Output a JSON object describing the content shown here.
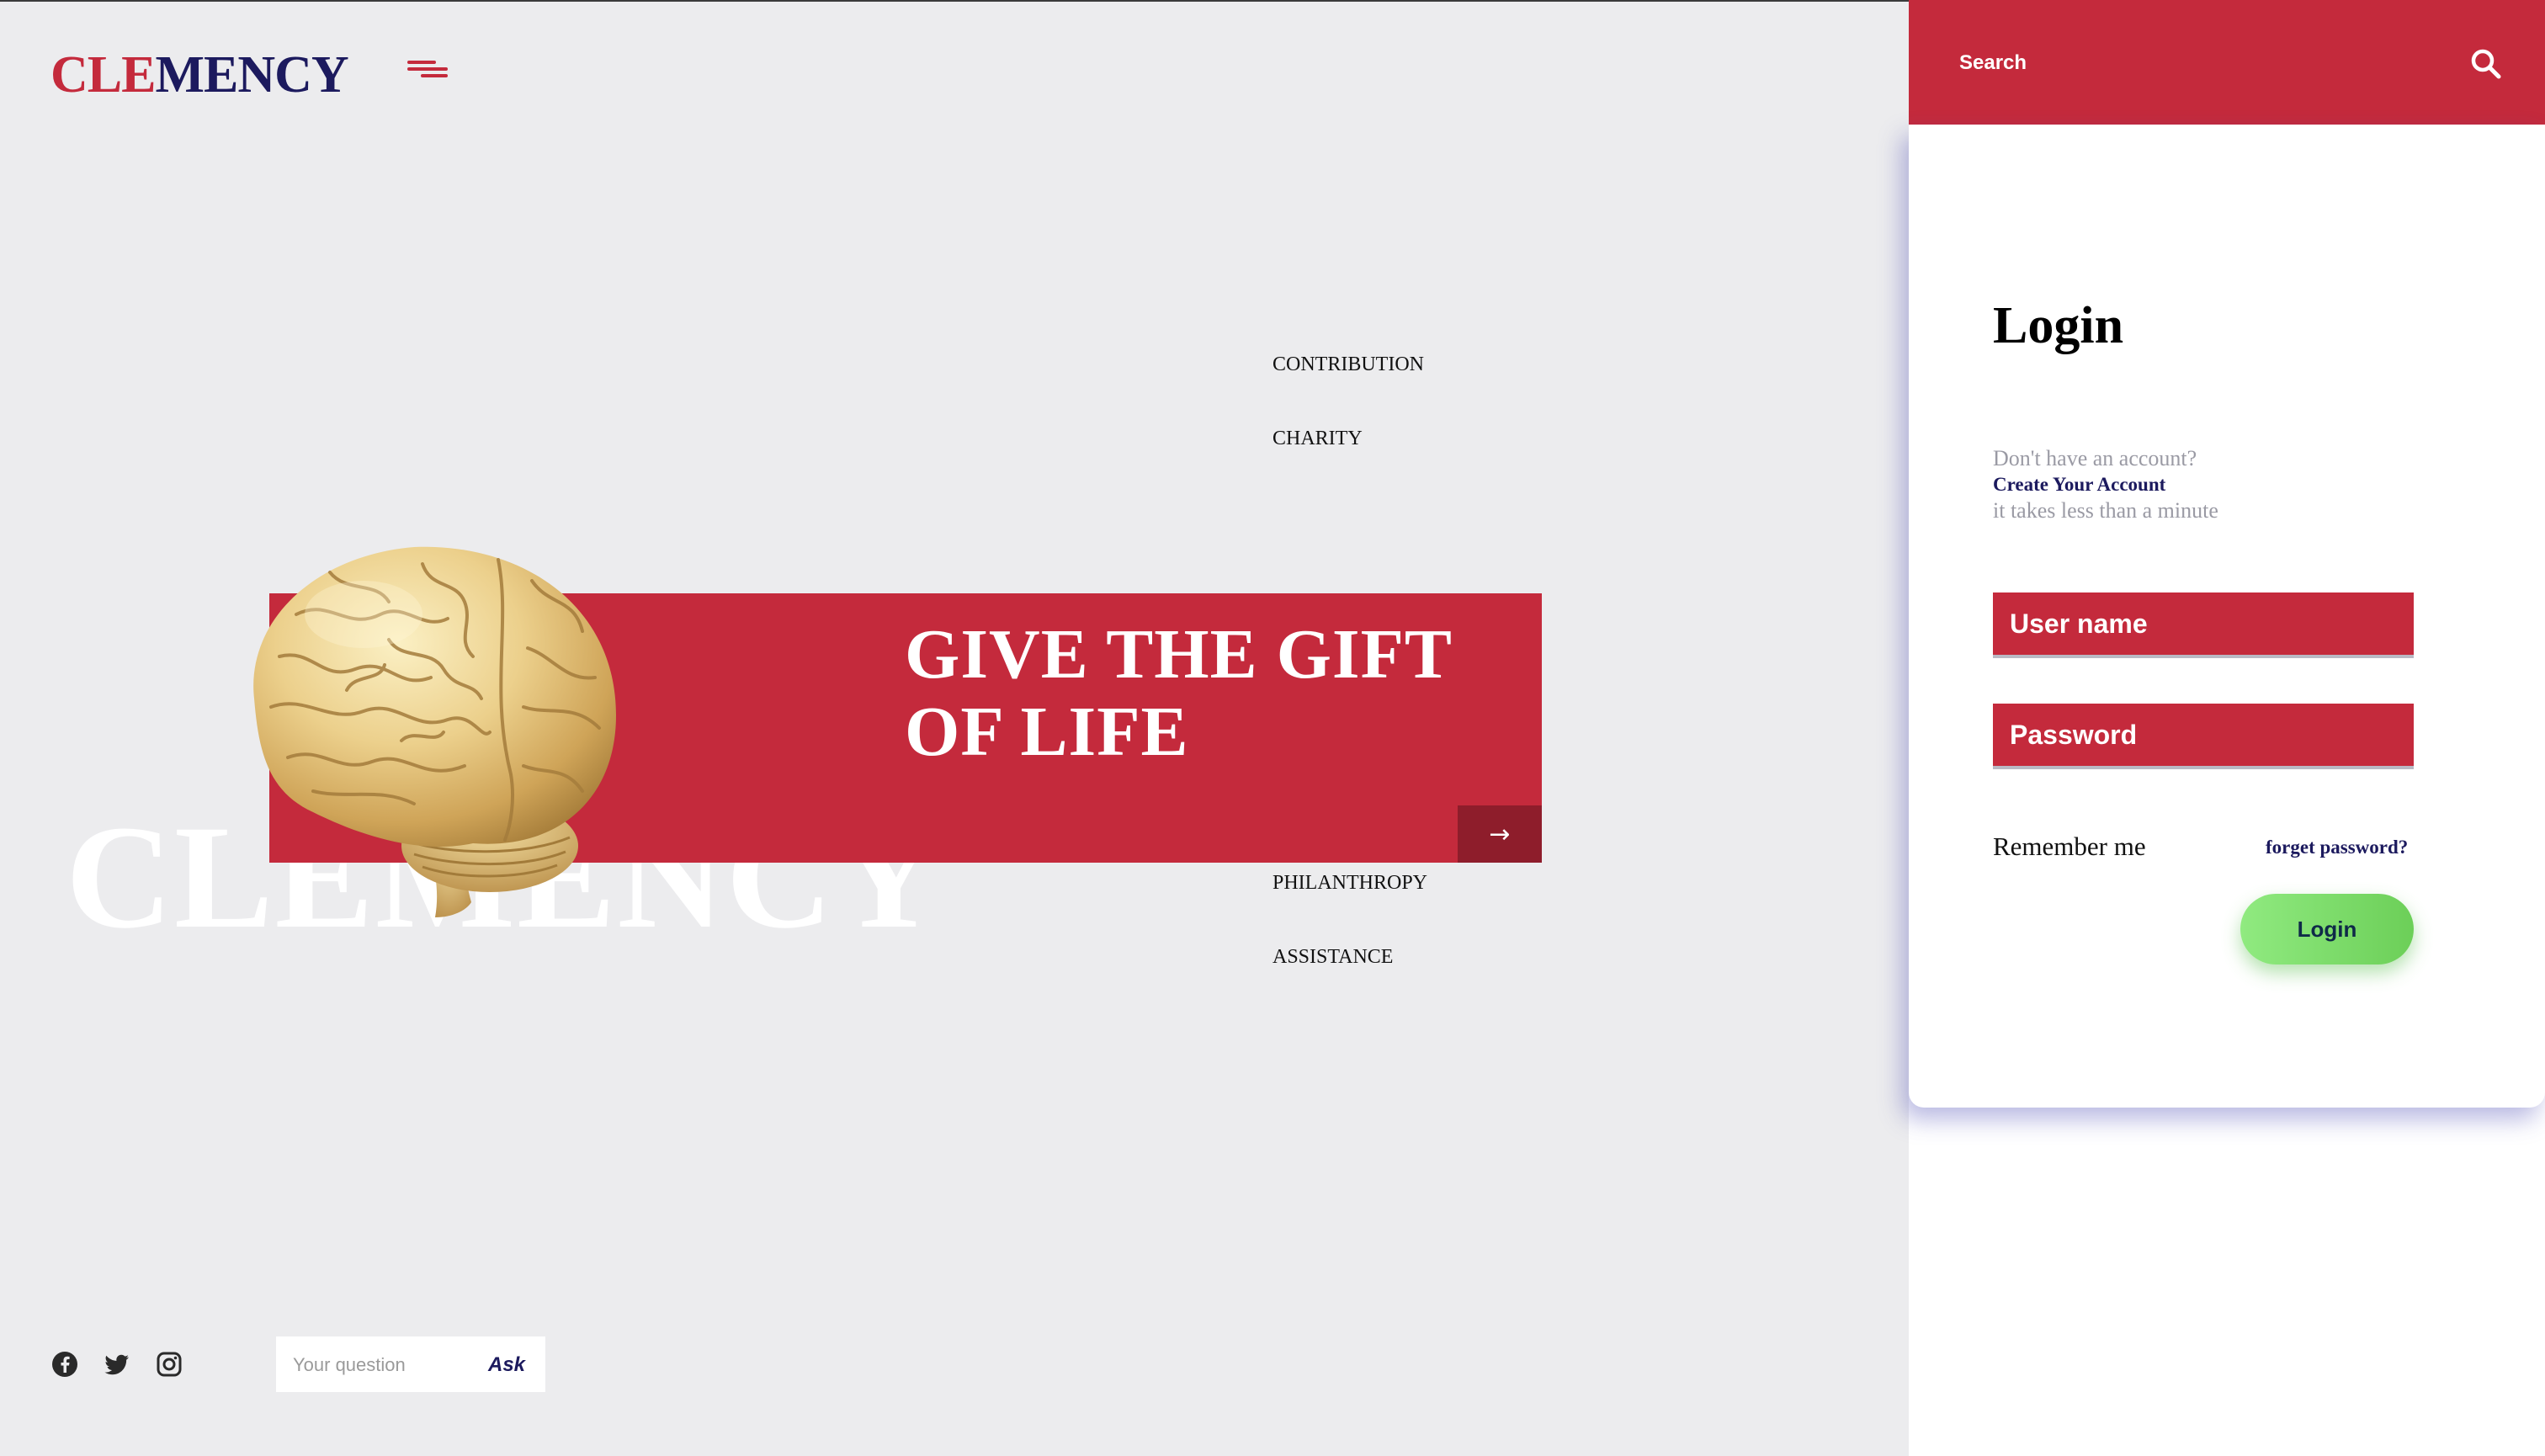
{
  "header": {
    "logo_part1": "CLE",
    "logo_part2": "MENCY"
  },
  "nav": {
    "items": [
      "CONTRIBUTION",
      "CHARITY",
      "PHILANTHROPY",
      "ASSISTANCE"
    ]
  },
  "hero": {
    "title_line1": "GIVE THE GIFT",
    "title_line2": "OF LIFE",
    "watermark": "CLEMENCY"
  },
  "ask": {
    "placeholder": "Your question",
    "button_label": "Ask"
  },
  "search": {
    "placeholder": "Search"
  },
  "login": {
    "title": "Login",
    "note_line1": "Don't have an account?",
    "create_account_label": "Create Your Account",
    "note_line3": "it takes less than a minute",
    "username_placeholder": "User name",
    "password_placeholder": "Password",
    "remember_label": "Remember me",
    "forget_label": "forget password?",
    "button_label": "Login"
  },
  "socials": [
    "facebook-icon",
    "twitter-icon",
    "instagram-icon"
  ],
  "colors": {
    "brand_red": "#c42a3c",
    "brand_navy": "#1c1a5e",
    "background": "#ececee",
    "login_green": "#7ddc6a"
  }
}
